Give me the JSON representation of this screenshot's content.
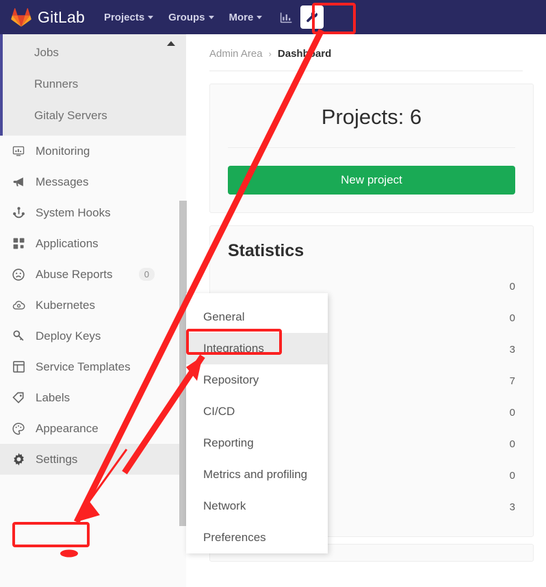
{
  "navbar": {
    "brand": "GitLab",
    "links": [
      {
        "label": "Projects",
        "icon": "chevron-down-icon"
      },
      {
        "label": "Groups",
        "icon": "chevron-down-icon"
      },
      {
        "label": "More",
        "icon": "chevron-down-icon"
      }
    ],
    "icons": [
      {
        "name": "analytics-icon",
        "active": false
      },
      {
        "name": "wrench-admin-icon",
        "active": true
      }
    ],
    "background_color": "#292961"
  },
  "sidebar": {
    "subgroup_items": [
      {
        "label": "Jobs"
      },
      {
        "label": "Runners"
      },
      {
        "label": "Gitaly Servers"
      }
    ],
    "items": [
      {
        "label": "Monitoring",
        "icon": "monitor-icon",
        "badge": ""
      },
      {
        "label": "Messages",
        "icon": "megaphone-icon",
        "badge": ""
      },
      {
        "label": "System Hooks",
        "icon": "hook-icon",
        "badge": ""
      },
      {
        "label": "Applications",
        "icon": "grid-apps-icon",
        "badge": ""
      },
      {
        "label": "Abuse Reports",
        "icon": "frown-face-icon",
        "badge": "0"
      },
      {
        "label": "Kubernetes",
        "icon": "kubernetes-cloud-icon",
        "badge": ""
      },
      {
        "label": "Deploy Keys",
        "icon": "key-icon",
        "badge": ""
      },
      {
        "label": "Service Templates",
        "icon": "template-icon",
        "badge": ""
      },
      {
        "label": "Labels",
        "icon": "label-tag-icon",
        "badge": ""
      },
      {
        "label": "Appearance",
        "icon": "palette-icon",
        "badge": ""
      },
      {
        "label": "Settings",
        "icon": "gear-icon",
        "badge": ""
      }
    ],
    "active_item": "Settings"
  },
  "flyout": {
    "items": [
      {
        "label": "General",
        "active": false
      },
      {
        "label": "Integrations",
        "active": true
      },
      {
        "label": "Repository",
        "active": false
      },
      {
        "label": "CI/CD",
        "active": false
      },
      {
        "label": "Reporting",
        "active": false
      },
      {
        "label": "Metrics and profiling",
        "active": false
      },
      {
        "label": "Network",
        "active": false
      },
      {
        "label": "Preferences",
        "active": false
      }
    ]
  },
  "main": {
    "breadcrumb": {
      "root": "Admin Area",
      "separator": "›",
      "current": "Dashboard"
    },
    "projects_card": {
      "count_label": "Projects: 6",
      "new_project_button": "New project",
      "button_color": "#1aaa55"
    },
    "statistics": {
      "title": "Statistics",
      "rows": [
        {
          "label": "",
          "value": "0"
        },
        {
          "label": "",
          "value": "0"
        },
        {
          "label": "",
          "value": "3"
        },
        {
          "label": "",
          "value": "7"
        },
        {
          "label": "",
          "value": "0"
        },
        {
          "label": "",
          "value": "0"
        },
        {
          "label": "",
          "value": "0"
        },
        {
          "label": "",
          "value": "3"
        }
      ]
    }
  },
  "annotations": {
    "highlight_color": "#fb2121",
    "boxes": [
      {
        "name": "wrench-admin-icon-highlight"
      },
      {
        "name": "settings-item-highlight"
      },
      {
        "name": "integrations-item-highlight"
      }
    ]
  }
}
